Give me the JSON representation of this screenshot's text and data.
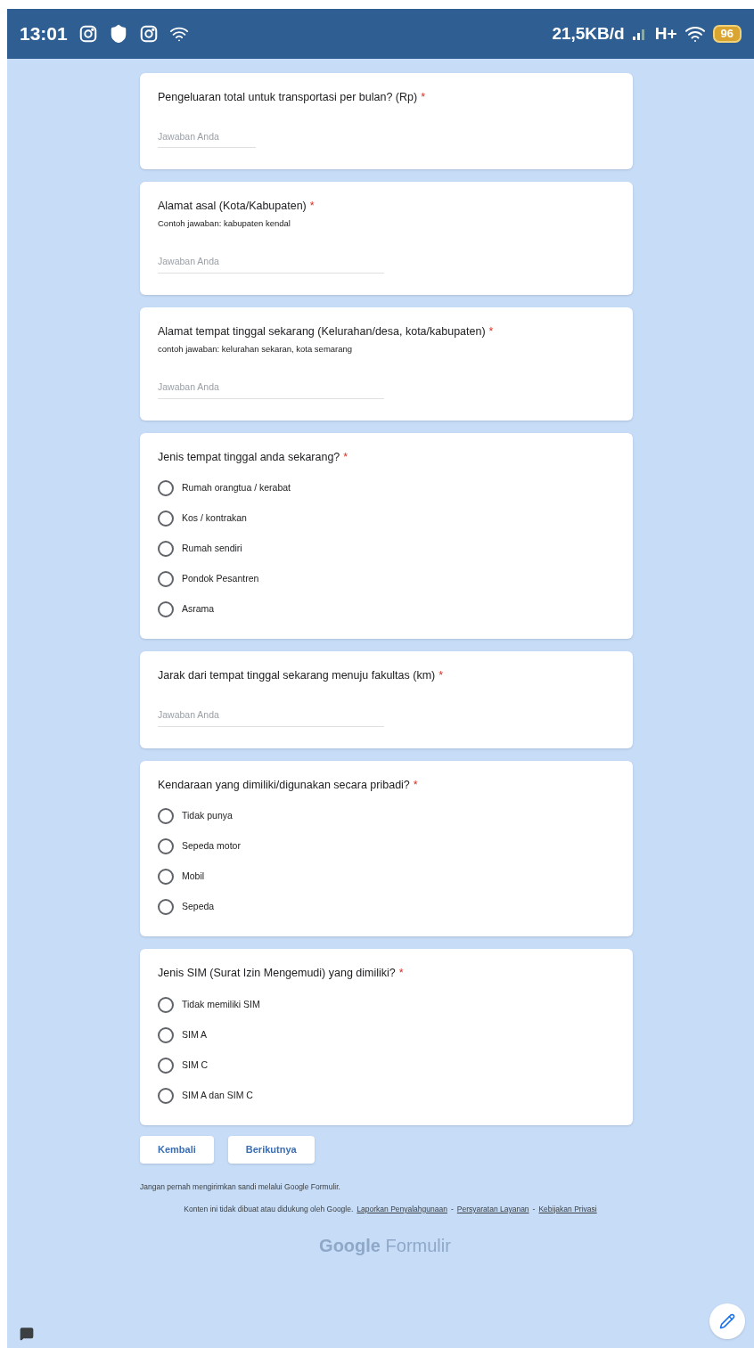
{
  "status_bar": {
    "time": "13:01",
    "net_speed": "21,5KB/d",
    "network_type": "H+",
    "battery": "96"
  },
  "questions": [
    {
      "kind": "text",
      "title": "Pengeluaran total untuk transportasi per bulan? (Rp)",
      "required_mark": "*",
      "placeholder": "Jawaban Anda"
    },
    {
      "kind": "text",
      "title": "Alamat asal (Kota/Kabupaten)",
      "required_mark": "*",
      "description": "Contoh jawaban: kabupaten kendal",
      "placeholder": "Jawaban Anda"
    },
    {
      "kind": "text",
      "title": "Alamat tempat tinggal sekarang (Kelurahan/desa, kota/kabupaten)",
      "required_mark": "*",
      "description": "contoh jawaban: kelurahan sekaran, kota semarang",
      "placeholder": "Jawaban Anda"
    },
    {
      "kind": "radio",
      "title": "Jenis tempat tinggal anda sekarang?",
      "required_mark": "*",
      "options": [
        {
          "label": "Rumah orangtua / kerabat",
          "selected": false
        },
        {
          "label": "Kos / kontrakan",
          "selected": false
        },
        {
          "label": "Rumah sendiri",
          "selected": false
        },
        {
          "label": "Pondok Pesantren",
          "selected": false
        },
        {
          "label": "Asrama",
          "selected": false
        }
      ]
    },
    {
      "kind": "text",
      "title": "Jarak dari tempat tinggal sekarang menuju fakultas (km)",
      "required_mark": "*",
      "placeholder": "Jawaban Anda"
    },
    {
      "kind": "radio",
      "title": "Kendaraan yang dimiliki/digunakan secara pribadi?",
      "required_mark": "*",
      "options": [
        {
          "label": "Tidak punya",
          "selected": false
        },
        {
          "label": "Sepeda motor",
          "selected": false
        },
        {
          "label": "Mobil",
          "selected": false
        },
        {
          "label": "Sepeda",
          "selected": false
        }
      ]
    },
    {
      "kind": "radio",
      "title": "Jenis SIM (Surat Izin Mengemudi) yang dimiliki?",
      "required_mark": "*",
      "options": [
        {
          "label": "Tidak memiliki SIM",
          "selected": false
        },
        {
          "label": "SIM A",
          "selected": false
        },
        {
          "label": "SIM C",
          "selected": false
        },
        {
          "label": "SIM A dan SIM C",
          "selected": false
        }
      ]
    }
  ],
  "buttons": [
    "Kembali",
    "Berikutnya"
  ],
  "footer": {
    "warning": "Jangan pernah mengirimkan sandi melalui Google Formulir.",
    "notice": "Konten ini tidak dibuat atau didukung oleh Google.",
    "links": [
      "Laporkan Penyalahgunaan",
      "Persyaratan Layanan",
      "Kebijakan Privasi"
    ],
    "separator": "-",
    "brand_google": "Google",
    "brand_product": "Formulir"
  }
}
